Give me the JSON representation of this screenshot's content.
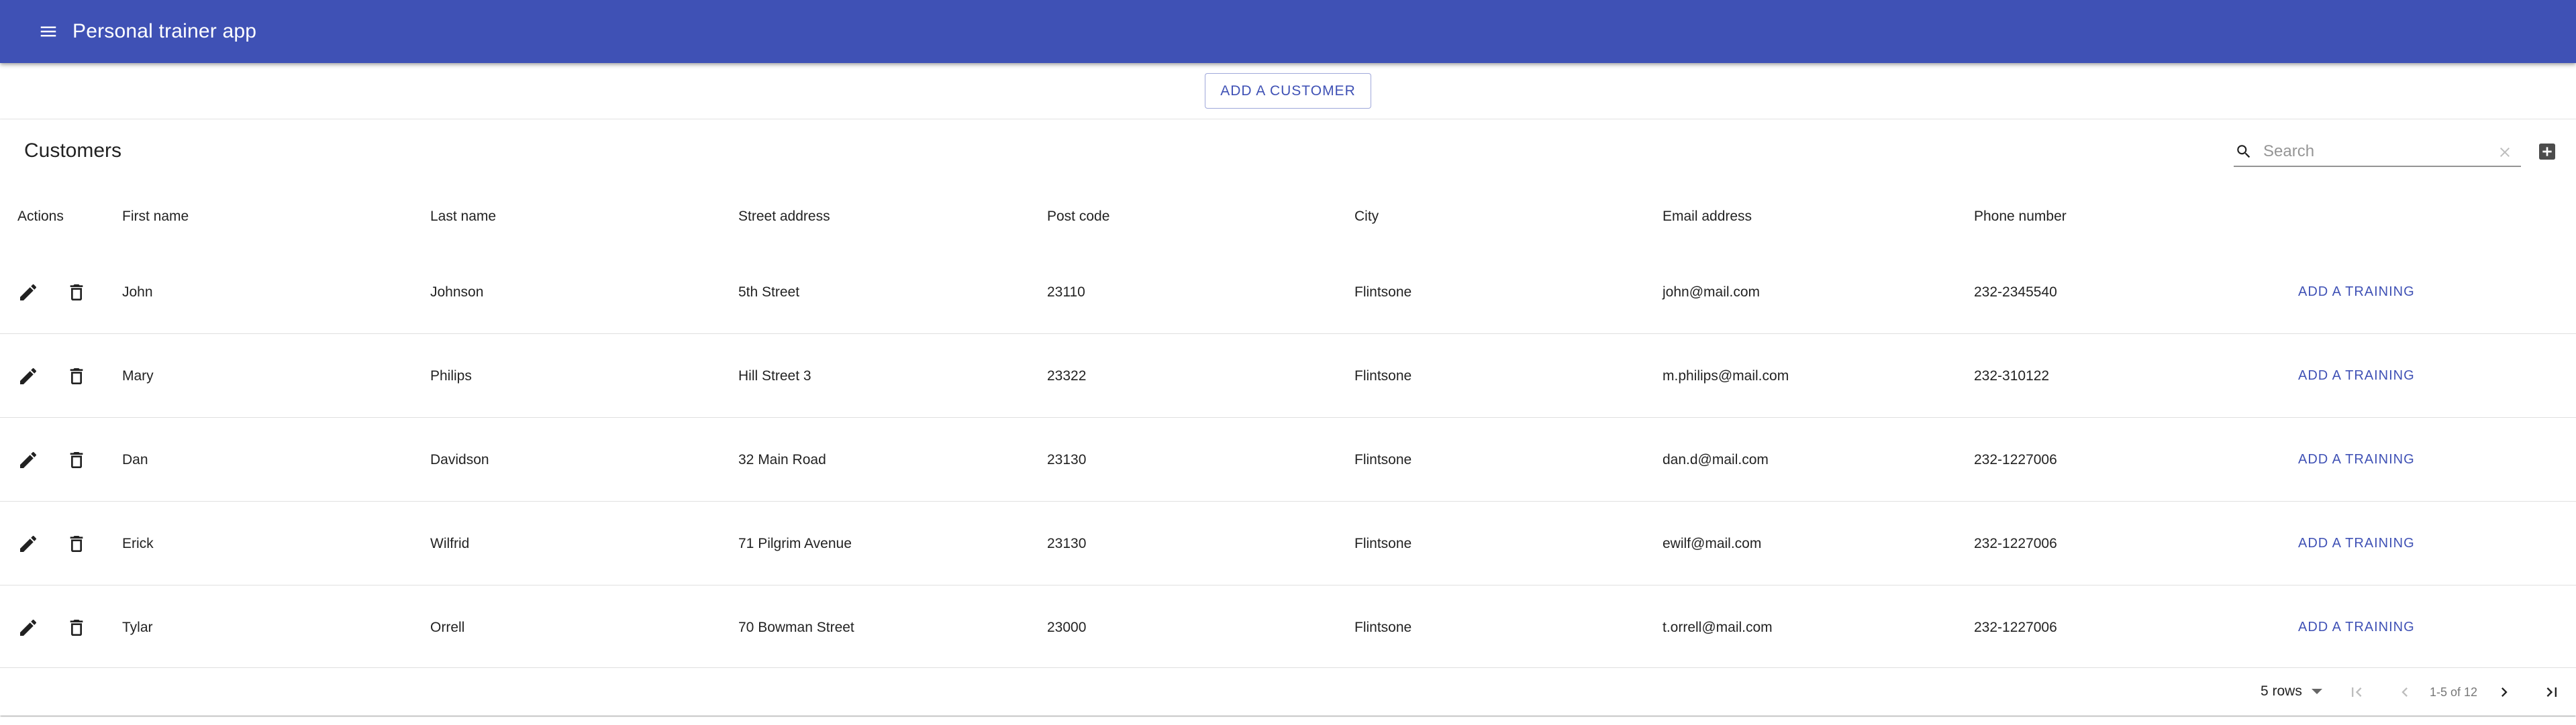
{
  "app": {
    "title": "Personal trainer app"
  },
  "actions": {
    "add_customer_label": "ADD A CUSTOMER"
  },
  "table": {
    "title": "Customers",
    "search_placeholder": "Search",
    "columns": [
      "Actions",
      "First name",
      "Last name",
      "Street address",
      "Post code",
      "City",
      "Email address",
      "Phone number"
    ],
    "row_action_label": "ADD A TRAINING",
    "rows": [
      {
        "first": "John",
        "last": "Johnson",
        "street": "5th Street",
        "post": "23110",
        "city": "Flintsone",
        "email": "john@mail.com",
        "phone": "232-2345540"
      },
      {
        "first": "Mary",
        "last": "Philips",
        "street": "Hill Street 3",
        "post": "23322",
        "city": "Flintsone",
        "email": "m.philips@mail.com",
        "phone": "232-310122"
      },
      {
        "first": "Dan",
        "last": "Davidson",
        "street": "32 Main Road",
        "post": "23130",
        "city": "Flintsone",
        "email": "dan.d@mail.com",
        "phone": "232-1227006"
      },
      {
        "first": "Erick",
        "last": "Wilfrid",
        "street": "71 Pilgrim Avenue",
        "post": "23130",
        "city": "Flintsone",
        "email": "ewilf@mail.com",
        "phone": "232-1227006"
      },
      {
        "first": "Tylar",
        "last": "Orrell",
        "street": "70 Bowman Street",
        "post": "23000",
        "city": "Flintsone",
        "email": "t.orrell@mail.com",
        "phone": "232-1227006"
      }
    ],
    "pagination": {
      "rows_per_page": "5 rows",
      "info": "1-5 of 12"
    }
  },
  "icons": {
    "menu": "menu-icon",
    "search": "search-icon",
    "clear": "close-icon",
    "add_column": "add-box-icon",
    "edit": "edit-icon",
    "delete": "delete-icon",
    "first_page": "first-page-icon",
    "prev_page": "chevron-left-icon",
    "next_page": "chevron-right-icon",
    "last_page": "last-page-icon"
  },
  "colors": {
    "primary": "#3f51b5",
    "appbar_text": "#ffffff"
  }
}
